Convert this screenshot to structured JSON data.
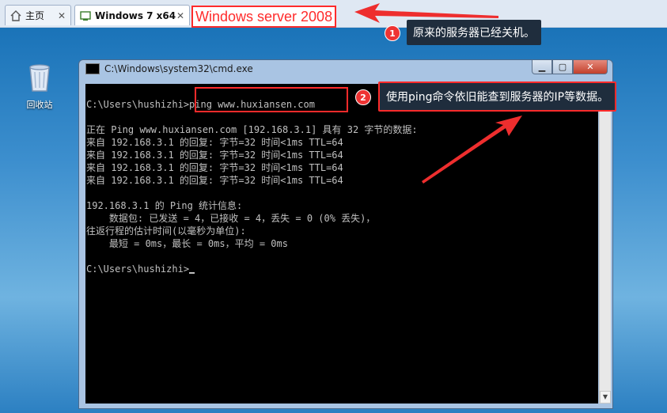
{
  "tabs": [
    {
      "label": "主页"
    },
    {
      "label": "Windows 7 x64"
    }
  ],
  "annotation_title": "Windows server 2008",
  "callouts": [
    {
      "number": "1",
      "text": "原来的服务器已经关机。"
    },
    {
      "number": "2",
      "text": "使用ping命令依旧能查到服务器的IP等数据。"
    }
  ],
  "desktop": {
    "recycle_bin_label": "回收站"
  },
  "cmd_window": {
    "title": "C:\\Windows\\system32\\cmd.exe",
    "lines": [
      "",
      "C:\\Users\\hushizhi>ping www.huxiansen.com",
      "",
      "正在 Ping www.huxiansen.com [192.168.3.1] 具有 32 字节的数据:",
      "来自 192.168.3.1 的回复: 字节=32 时间<1ms TTL=64",
      "来自 192.168.3.1 的回复: 字节=32 时间<1ms TTL=64",
      "来自 192.168.3.1 的回复: 字节=32 时间<1ms TTL=64",
      "来自 192.168.3.1 的回复: 字节=32 时间<1ms TTL=64",
      "",
      "192.168.3.1 的 Ping 统计信息:",
      "    数据包: 已发送 = 4，已接收 = 4，丢失 = 0 (0% 丢失)，",
      "往返行程的估计时间(以毫秒为单位):",
      "    最短 = 0ms，最长 = 0ms，平均 = 0ms",
      "",
      "C:\\Users\\hushizhi>"
    ]
  },
  "colors": {
    "annotation_red": "#ff2b2b",
    "callout_bg": "#1f2d3d"
  }
}
